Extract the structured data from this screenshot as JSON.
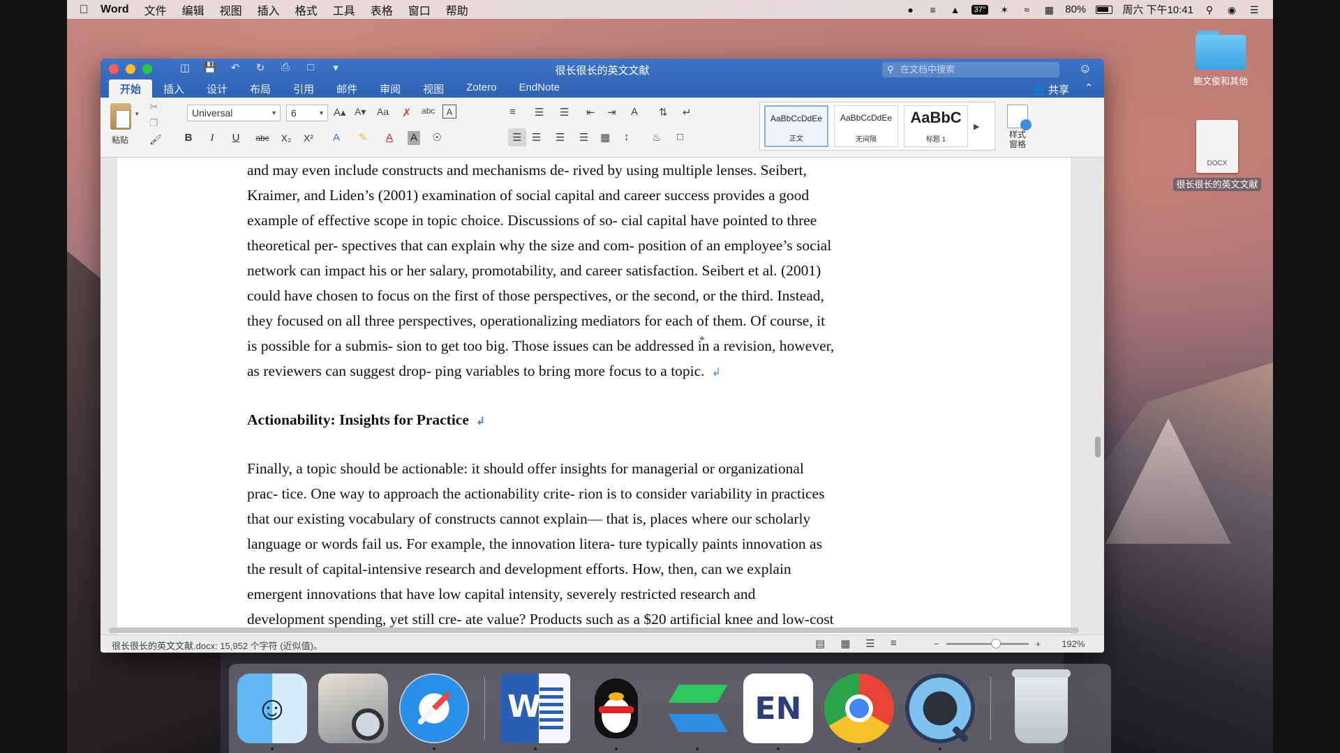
{
  "menubar": {
    "app_name": "Word",
    "items": [
      "文件",
      "编辑",
      "视图",
      "插入",
      "格式",
      "工具",
      "表格",
      "窗口",
      "帮助"
    ],
    "temperature": "37°",
    "battery_percent": "80%",
    "clock": "周六 下午10:41"
  },
  "desktop": {
    "folder_label": "鲍文俊和其他",
    "file_label": "很长很长的英文文献",
    "file_type": "DOCX"
  },
  "window": {
    "title": "很长很长的英文文献",
    "search_placeholder": "在文档中搜索",
    "tabs": [
      "开始",
      "插入",
      "设计",
      "布局",
      "引用",
      "邮件",
      "审阅",
      "视图",
      "Zotero",
      "EndNote"
    ],
    "active_tab": "开始",
    "share_label": "共享"
  },
  "ribbon": {
    "paste_label": "粘贴",
    "font_name": "Universal",
    "font_size": "6",
    "styles": [
      {
        "sample": "AaBbCcDdEe",
        "name": "正文"
      },
      {
        "sample": "AaBbCcDdEe",
        "name": "无间隔"
      },
      {
        "sample": "AaBbC",
        "name": "标题 1"
      }
    ],
    "style_pane_label_1": "样式",
    "style_pane_label_2": "窗格"
  },
  "document": {
    "para1": [
      "and may even include constructs and mechanisms de- rived by using multiple lenses. Seibert,",
      "Kraimer, and Liden’s (2001) examination of social capital and career success provides a good",
      "example of effective scope in topic choice. Discussions of so- cial capital have pointed to three",
      "theoretical per- spectives that can explain why the size and com- position of an employee’s social",
      "network can impact his or her salary, promotability, and career satisfaction. Seibert et al. (2001)",
      "could have chosen to focus on the first of those perspectives, or the second, or the third. Instead,",
      "they focused on all three perspectives, operationalizing mediators for each of them. Of course, it",
      "is possible for a submis- sion to get too big. Those issues can be addressed in a revision, however,",
      "as reviewers can suggest drop- ping variables to bring more focus to a topic."
    ],
    "heading": "Actionability: Insights for Practice",
    "para2": [
      "Finally, a topic should be actionable: it should offer insights for managerial or organizational",
      "prac- tice. One way to approach the actionability crite- rion is to consider variability in practices",
      "that our existing vocabulary of constructs cannot explain— that is, places where our scholarly",
      "language or words fail us. For example, the innovation litera- ture typically paints innovation as",
      "the result of capital-intensive research and development efforts. How, then, can we explain",
      "emergent innovations that have low capital intensity, severely restricted research and",
      "development spending, yet still cre- ate value? Products such as a $20 artificial knee and low-cost"
    ]
  },
  "statusbar": {
    "info": "很长很长的英文文献.docx: 15,952 个字符 (近似值)。",
    "zoom": "192%"
  }
}
